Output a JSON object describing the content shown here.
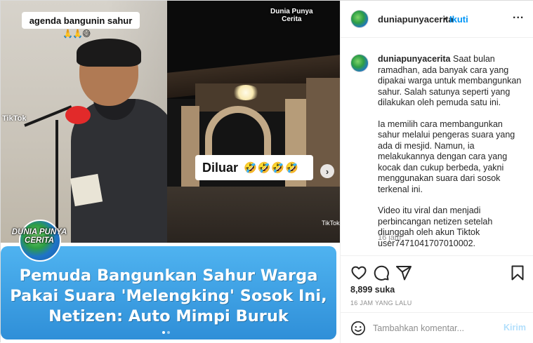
{
  "media": {
    "left_caption": "agenda bangunin sahur",
    "left_emoji": "🙏🙏😅",
    "brand_line1": "Dunia Punya",
    "brand_line2": "Cerita",
    "outside_label": "Diluar",
    "outside_emoji": "🤣🤣🤣🤣",
    "tiktok_left": "TikTok",
    "tiktok_right": "TikTok",
    "globe_line1": "DUNIA PUNYA",
    "globe_line2": "CERITA",
    "headline_line1": "Pemuda Bangunkan Sahur Warga",
    "headline_line2": "Pakai Suara 'Melengking' Sosok Ini,",
    "headline_line3": "Netizen: Auto Mimpi Buruk",
    "next_icon": "chevron-right-icon",
    "carousel": {
      "count": 2,
      "active": 1
    }
  },
  "header": {
    "username": "duniapunyacerita",
    "separator": "•",
    "follow_label": "Ikuti",
    "more_label": "..."
  },
  "caption": {
    "username": "duniapunyacerita",
    "para1": "Saat bulan ramadhan, ada banyak cara yang dipakai warga untuk membangunkan sahur. Salah satunya seperti yang dilakukan oleh pemuda satu ini.",
    "para2": "Ia memilih cara membangunkan sahur melalui pengeras suara yang ada di mesjid. Namun, ia melakukannya dengan cara yang kocak dan cukup berbeda, yakni menggunakan suara dari sosok terkenal ini.",
    "para3": "Video itu viral dan menjadi perbincangan netizen setelah diunggah oleh akun Tiktok user7471041707010002.",
    "time": "16 jam"
  },
  "actions": {
    "icons": [
      "heart-icon",
      "comment-icon",
      "share-icon",
      "bookmark-icon"
    ],
    "likes": "8,899 suka",
    "posted": "16 JAM YANG LALU"
  },
  "comment": {
    "placeholder": "Tambahkan komentar...",
    "send_label": "Kirim",
    "emoji_icon": "smiley-icon"
  }
}
